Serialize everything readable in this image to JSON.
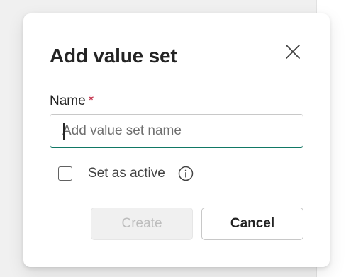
{
  "dialog": {
    "title": "Add value set",
    "name_field": {
      "label": "Name",
      "required_marker": "*",
      "value": "",
      "placeholder": "Add value set name"
    },
    "set_active": {
      "label": "Set as active",
      "checked": false
    },
    "buttons": {
      "create_label": "Create",
      "cancel_label": "Cancel"
    },
    "icons": {
      "close": "close-icon",
      "info": "info-icon"
    }
  },
  "colors": {
    "accent_focus_underline": "#117865",
    "required_star": "#c4314b",
    "disabled_button_bg": "#f0f0f0",
    "disabled_button_text": "#bdbdbd"
  }
}
